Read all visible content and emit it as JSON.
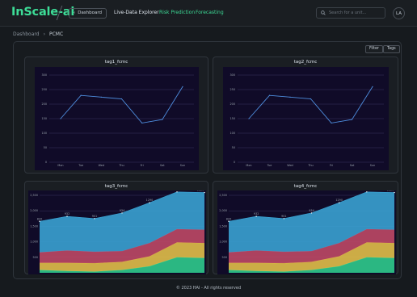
{
  "app": {
    "brand": "InScale-ai"
  },
  "header": {
    "back_label": "Dashboard",
    "nav": [
      "Live-Data Explorer",
      "Risk Prediction",
      "Forecasting"
    ],
    "search_placeholder": "Search for a unit...",
    "avatar": "LA"
  },
  "breadcrumb": {
    "root": "Dashboard",
    "sep": "›",
    "current": "PCMC"
  },
  "toolbar": {
    "filter": "Filter",
    "tags": "Tags"
  },
  "colors": {
    "accent": "#3ddc97",
    "line": "#4f8fe0",
    "plot_bg": "#100b28"
  },
  "footer": "© 2023 HAI - All rights reserved",
  "chart_data": [
    {
      "type": "line",
      "title": "tag1_fcmc",
      "categories": [
        "Mon",
        "Tue",
        "Wed",
        "Thu",
        "Fri",
        "Sat",
        "Sun"
      ],
      "values": [
        150,
        230,
        224,
        218,
        135,
        147,
        260
      ],
      "ylim": [
        0,
        300
      ],
      "yticks": [
        0,
        50,
        100,
        150,
        200,
        250,
        300
      ],
      "grid": true
    },
    {
      "type": "line",
      "title": "tag2_fcmc",
      "categories": [
        "Mon",
        "Tue",
        "Wed",
        "Thu",
        "Fri",
        "Sat",
        "Sun"
      ],
      "values": [
        150,
        230,
        224,
        218,
        135,
        147,
        260
      ],
      "ylim": [
        0,
        300
      ],
      "yticks": [
        0,
        50,
        100,
        150,
        200,
        250,
        300
      ],
      "grid": true
    },
    {
      "type": "area",
      "title": "tag3_fcmc",
      "ylim": [
        0,
        2500
      ],
      "yticks": [
        500,
        1000,
        1500,
        2000,
        2500
      ],
      "point_labels": [
        "820",
        "932",
        "901",
        "934",
        "1290",
        "1330",
        "1320"
      ],
      "series": [
        {
          "color": "#2fcf8e",
          "values": [
            90,
            60,
            40,
            90,
            210,
            500,
            480
          ]
        },
        {
          "color": "#e6c34a",
          "values": [
            230,
            260,
            270,
            260,
            320,
            480,
            480
          ]
        },
        {
          "color": "#c24a67",
          "values": [
            340,
            400,
            370,
            350,
            430,
            430,
            430
          ]
        },
        {
          "color": "#3aa5d6",
          "values": [
            1000,
            1100,
            1070,
            1230,
            1300,
            1200,
            1200
          ]
        }
      ]
    },
    {
      "type": "area",
      "title": "tag4_fcmc",
      "ylim": [
        0,
        2500
      ],
      "yticks": [
        500,
        1000,
        1500,
        2000,
        2500
      ],
      "point_labels": [
        "820",
        "932",
        "901",
        "934",
        "1290",
        "1330",
        "1320"
      ],
      "series": [
        {
          "color": "#2fcf8e",
          "values": [
            90,
            60,
            40,
            90,
            210,
            500,
            480
          ]
        },
        {
          "color": "#e6c34a",
          "values": [
            230,
            260,
            270,
            260,
            320,
            480,
            480
          ]
        },
        {
          "color": "#c24a67",
          "values": [
            340,
            400,
            370,
            350,
            430,
            430,
            430
          ]
        },
        {
          "color": "#3aa5d6",
          "values": [
            1000,
            1100,
            1070,
            1230,
            1300,
            1200,
            1200
          ]
        }
      ]
    }
  ]
}
